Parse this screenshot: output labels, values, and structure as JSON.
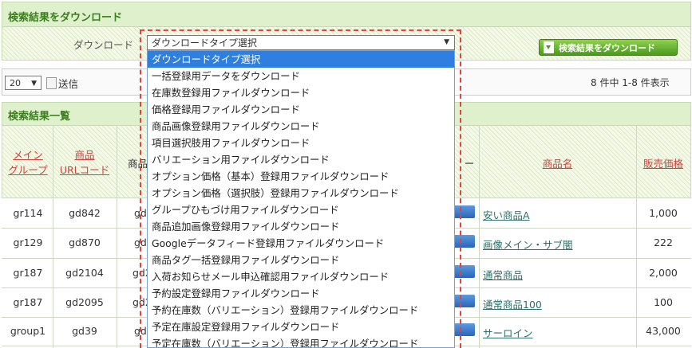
{
  "download_section": {
    "title": "検索結果をダウンロード",
    "label": "ダウンロード",
    "select_value": "ダウンロードタイプ選択",
    "button_label": "検索結果をダウンロード",
    "options": [
      "ダウンロードタイプ選択",
      "一括登録用データをダウンロード",
      "在庫数登録用ファイルダウンロード",
      "価格登録用ファイルダウンロード",
      "商品画像登録用ファイルダウンロード",
      "項目選択肢用ファイルダウンロード",
      "バリエーション用ファイルダウンロード",
      "オプション価格（基本）登録用ファイルダウンロード",
      "オプション価格（選択肢）登録用ファイルダウンロード",
      "グループひもづけ用ファイルダウンロード",
      "商品追加画像登録用ファイルダウンロード",
      "Googleデータフィード登録用ファイルダウンロード",
      "商品タグ一括登録用ファイルダウンロード",
      "入荷お知らせメール申込確認用ファイルダウンロード",
      "予約設定登録用ファイルダウンロード",
      "予約在庫数（バリエーション）登録用ファイルダウンロード",
      "予定在庫設定登録用ファイルダウンロード",
      "予定在庫数（バリエーション）登録用ファイルダウンロード"
    ]
  },
  "pager": {
    "per_page": "20",
    "send_label": "送信",
    "summary": "8 件中 1-8 件表示"
  },
  "results": {
    "title": "検索結果一覧",
    "headers": {
      "main_group": "メイン\nグループ",
      "product_url_code": "商品\nURLコード",
      "product_partial": "商品",
      "hidden_tail": "ー",
      "product_name": "商品名",
      "sale_price": "販売価格"
    },
    "rows": [
      {
        "group": "gr114",
        "code": "gd842",
        "partial": "gd",
        "name": "安い商品A",
        "price": "1,000"
      },
      {
        "group": "gr129",
        "code": "gd870",
        "partial": "gd",
        "name": "画像メイン・サブ闇",
        "price": "222"
      },
      {
        "group": "gr187",
        "code": "gd2104",
        "partial": "gd2",
        "name": "通常商品",
        "price": "2,000"
      },
      {
        "group": "gr187",
        "code": "gd2095",
        "partial": "gd2",
        "name": "通常商品100",
        "price": "100"
      },
      {
        "group": "group1",
        "code": "gd39",
        "partial": "gd",
        "name": "サーロイン",
        "price": "43,000"
      }
    ]
  }
}
